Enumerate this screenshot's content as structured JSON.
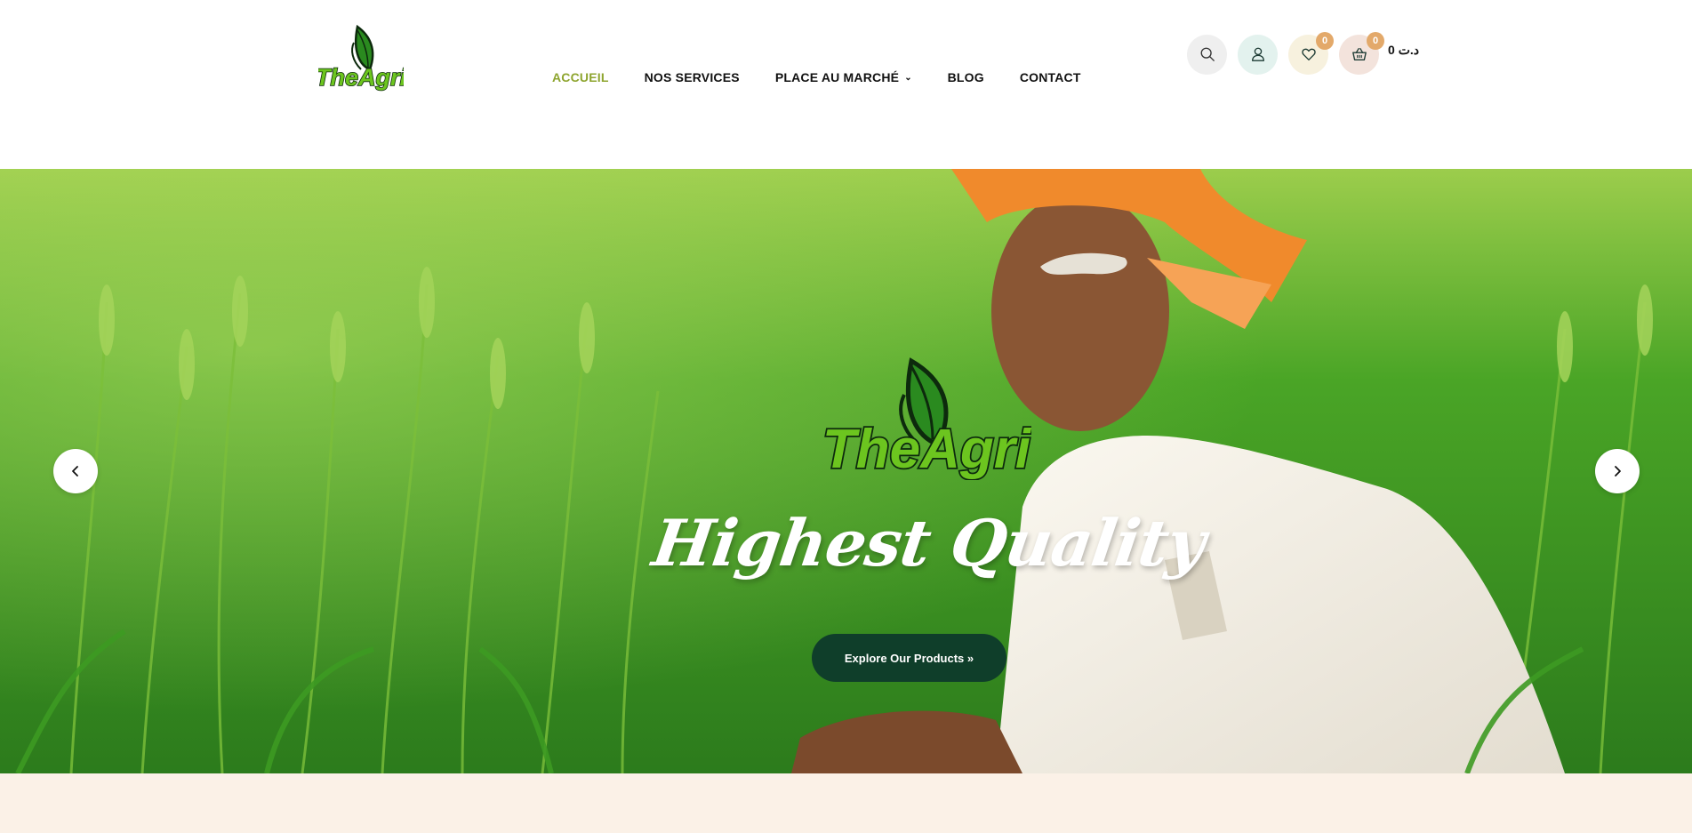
{
  "brand": {
    "logo_text": "TheAgri"
  },
  "nav": {
    "items": [
      {
        "label": "ACCUEIL",
        "active": true
      },
      {
        "label": "NOS SERVICES",
        "active": false
      },
      {
        "label": "PLACE AU MARCHÉ",
        "active": false,
        "has_dropdown": true
      },
      {
        "label": "BLOG",
        "active": false
      },
      {
        "label": "CONTACT",
        "active": false
      }
    ],
    "active_color": "#8ea52f",
    "dropdown_icon": "chevron-down-icon"
  },
  "header_actions": {
    "search_icon": "search-icon",
    "account_icon": "user-icon",
    "wishlist_icon": "heart-icon",
    "wishlist_count": "0",
    "cart_icon": "basket-icon",
    "cart_count": "0",
    "cart_total": "0 د.ت"
  },
  "hero": {
    "logo_text": "TheAgri",
    "headline": "Highest Quality",
    "cta_label": "Explore Our Products »",
    "prev_icon": "chevron-left-icon",
    "next_icon": "chevron-right-icon",
    "cta_color": "#0f3e2a"
  },
  "colors": {
    "badge": "#e3a96a",
    "below_section_bg": "#fbf1e7"
  }
}
